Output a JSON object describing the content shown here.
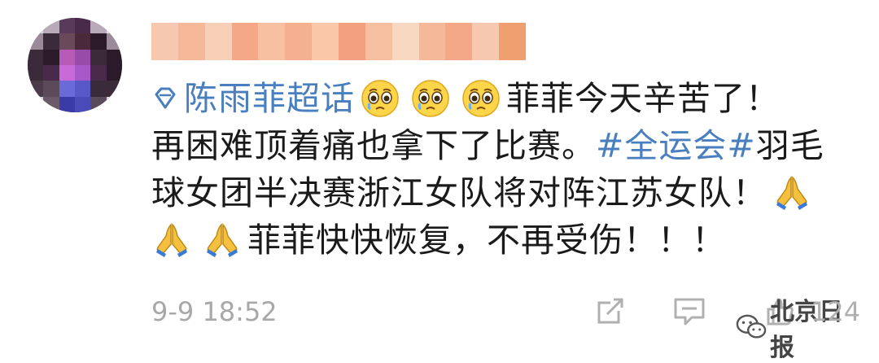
{
  "post": {
    "topic_name": "陈雨菲超话",
    "line1_text": "菲菲今天辛苦了！",
    "line2_text": "再困难顶着痛也拿下了比赛。",
    "hashtag": "#全运会#",
    "line2_tail": " 羽毛",
    "line3_text": "球女团半决赛浙江女队将对阵江苏女队！",
    "line4_text": "菲菲快快恢复，不再受伤！！！",
    "emojis_line1": [
      "crying-face-icon",
      "crying-face-icon",
      "crying-face-icon"
    ],
    "emojis_line3": [
      "praying-hands-icon"
    ],
    "emojis_line4": [
      "praying-hands-icon",
      "praying-hands-icon"
    ]
  },
  "footer": {
    "timestamp": "9-9 18:52",
    "like_count": "124",
    "watermark_text": "北京日报"
  },
  "colors": {
    "link": "#4a7fbf",
    "text": "#1a1a1a",
    "meta": "#a8a8a8"
  }
}
